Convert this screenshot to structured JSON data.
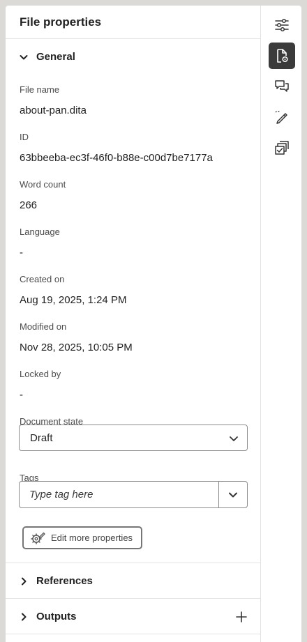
{
  "panel": {
    "title": "File properties"
  },
  "general": {
    "label": "General",
    "properties": [
      {
        "label": "File name",
        "value": "about-pan.dita"
      },
      {
        "label": "ID",
        "value": "63bbeeba-ec3f-46f0-b88e-c00d7be7177a"
      },
      {
        "label": "Word count",
        "value": "266"
      },
      {
        "label": "Language",
        "value": "-"
      },
      {
        "label": "Created on",
        "value": "Aug 19, 2025, 1:24 PM"
      },
      {
        "label": "Modified on",
        "value": "Nov 28, 2025, 10:05 PM"
      },
      {
        "label": "Locked by",
        "value": "-"
      }
    ],
    "document_state": {
      "label": "Document state",
      "value": "Draft"
    },
    "tags": {
      "label": "Tags",
      "placeholder": "Type tag here"
    },
    "edit_button": "Edit more properties"
  },
  "references": {
    "label": "References"
  },
  "outputs": {
    "label": "Outputs"
  },
  "rail": {
    "icons": [
      "sliders-icon",
      "file-settings-icon",
      "comments-icon",
      "pen-review-icon",
      "version-check-icon"
    ],
    "active_index": 1
  }
}
